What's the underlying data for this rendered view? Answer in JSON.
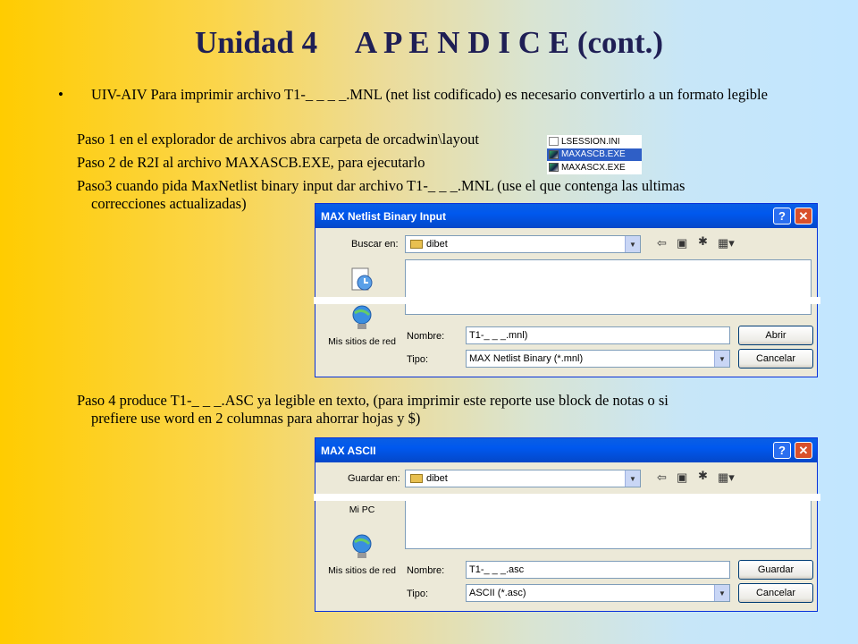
{
  "title": "Unidad 4     A P E N D I C E (cont.)",
  "bullet_text": "UIV-AIV Para imprimir archivo T1-_ _ _ _.MNL (net list codificado) es necesario convertirlo a un formato legible",
  "steps": {
    "step1": "Paso 1 en el explorador de archivos abra carpeta de orcadwin\\layout",
    "step2": "Paso 2 de R2I al archivo MAXASCB.EXE, para ejecutarlo",
    "step3_line1": "Paso3 cuando pida  MaxNetlist binary input dar archivo T1-_ _ _.MNL (use el que contenga las ultimas",
    "step3_line2": "correcciones actualizadas)",
    "step4_line1": "Paso 4  produce T1-_ _ _.ASC ya legible en texto, (para imprimir este reporte use block de notas o si",
    "step4_line2": "prefiere use word  en 2 columnas para ahorrar hojas y $)"
  },
  "file_list": [
    {
      "name": "LSESSION.INI",
      "icon": "ini-file-icon",
      "selected": false
    },
    {
      "name": "MAXASCB.EXE",
      "icon": "exe-file-icon",
      "selected": true
    },
    {
      "name": "MAXASCX.EXE",
      "icon": "exe-file-icon",
      "selected": false
    }
  ],
  "dialog_open": {
    "title": "MAX Netlist Binary Input",
    "look_in_label": "Buscar en:",
    "folder": "dibet",
    "place_label": "Mis sitios de red",
    "name_label": "Nombre:",
    "name_value": "T1-_ _ _.mnl)",
    "type_label": "Tipo:",
    "type_value": "MAX Netlist Binary (*.mnl)",
    "ok_button": "Abrir",
    "cancel_button": "Cancelar"
  },
  "dialog_save": {
    "title": "MAX ASCII",
    "look_in_label": "Guardar en:",
    "folder": "dibet",
    "place_top_label": "Mi PC",
    "place_label": "Mis sitios de red",
    "name_label": "Nombre:",
    "name_value": "T1-_ _ _.asc",
    "type_label": "Tipo:",
    "type_value": "ASCII (*.asc)",
    "ok_button": "Guardar",
    "cancel_button": "Cancelar"
  },
  "colors": {
    "title": "#1f1f55",
    "titlebar": "#0058ee",
    "selection": "#2f5fc6"
  }
}
